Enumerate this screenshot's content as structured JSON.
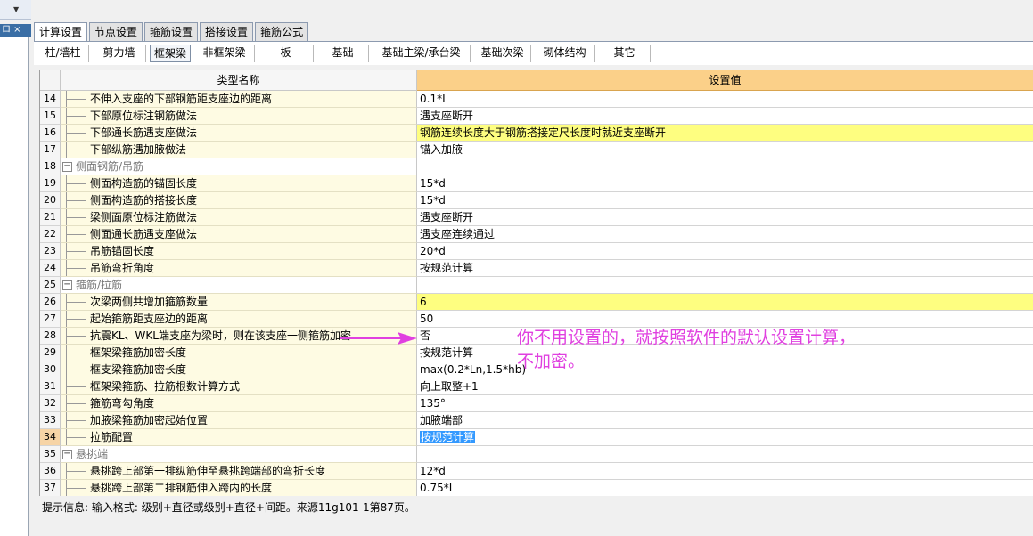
{
  "tabs": [
    "计算设置",
    "节点设置",
    "箍筋设置",
    "搭接设置",
    "箍筋公式"
  ],
  "active_tab_index": 0,
  "subtabs": [
    "柱/墙柱",
    "剪力墙",
    "框架梁",
    "非框架梁",
    "板",
    "基础",
    "基础主梁/承台梁",
    "基础次梁",
    "砌体结构",
    "其它"
  ],
  "active_subtab_index": 2,
  "grid": {
    "header_name": "类型名称",
    "header_value": "设置值",
    "rows": [
      {
        "num": "14",
        "name": "不伸入支座的下部钢筋距支座边的距离",
        "value": "0.1*L"
      },
      {
        "num": "15",
        "name": "下部原位标注钢筋做法",
        "value": "遇支座断开"
      },
      {
        "num": "16",
        "name": "下部通长筋遇支座做法",
        "value": "钢筋连续长度大于钢筋搭接定尺长度时就近支座断开",
        "highlight": true
      },
      {
        "num": "17",
        "name": "下部纵筋遇加腋做法",
        "value": "锚入加腋"
      },
      {
        "num": "18",
        "name": "侧面钢筋/吊筋",
        "value": "",
        "group": true
      },
      {
        "num": "19",
        "name": "侧面构造筋的锚固长度",
        "value": "15*d"
      },
      {
        "num": "20",
        "name": "侧面构造筋的搭接长度",
        "value": "15*d"
      },
      {
        "num": "21",
        "name": "梁侧面原位标注筋做法",
        "value": "遇支座断开"
      },
      {
        "num": "22",
        "name": "侧面通长筋遇支座做法",
        "value": "遇支座连续通过"
      },
      {
        "num": "23",
        "name": "吊筋锚固长度",
        "value": "20*d"
      },
      {
        "num": "24",
        "name": "吊筋弯折角度",
        "value": "按规范计算"
      },
      {
        "num": "25",
        "name": "箍筋/拉筋",
        "value": "",
        "group": true
      },
      {
        "num": "26",
        "name": "次梁两侧共增加箍筋数量",
        "value": "6",
        "highlight": true
      },
      {
        "num": "27",
        "name": "起始箍筋距支座边的距离",
        "value": "50"
      },
      {
        "num": "28",
        "name": "抗震KL、WKL端支座为梁时，则在该支座一侧箍筋加密",
        "value": "否"
      },
      {
        "num": "29",
        "name": "框架梁箍筋加密长度",
        "value": "按规范计算"
      },
      {
        "num": "30",
        "name": "框支梁箍筋加密长度",
        "value": "max(0.2*Ln,1.5*hb)"
      },
      {
        "num": "31",
        "name": "框架梁箍筋、拉筋根数计算方式",
        "value": "向上取整+1"
      },
      {
        "num": "32",
        "name": "箍筋弯勾角度",
        "value": "135°"
      },
      {
        "num": "33",
        "name": "加腋梁箍筋加密起始位置",
        "value": "加腋端部"
      },
      {
        "num": "34",
        "name": "拉筋配置",
        "value": "按规范计算",
        "selected": true
      },
      {
        "num": "35",
        "name": "悬挑端",
        "value": "",
        "group": true
      },
      {
        "num": "36",
        "name": "悬挑跨上部第一排纵筋伸至悬挑跨端部的弯折长度",
        "value": "12*d"
      },
      {
        "num": "37",
        "name": "悬挑跨上部第二排钢筋伸入跨内的长度",
        "value": "0.75*L"
      }
    ]
  },
  "status_text": "提示信息: 输入格式: 级别+直径或级别+直径+间距。来源11g101-1第87页。",
  "annotation": {
    "line1": "你不用设置的，就按照软件的默认设置计算，",
    "line2": "不加密。",
    "color": "#e040e0"
  },
  "left_panel": {
    "header_text": "ロ ×"
  }
}
